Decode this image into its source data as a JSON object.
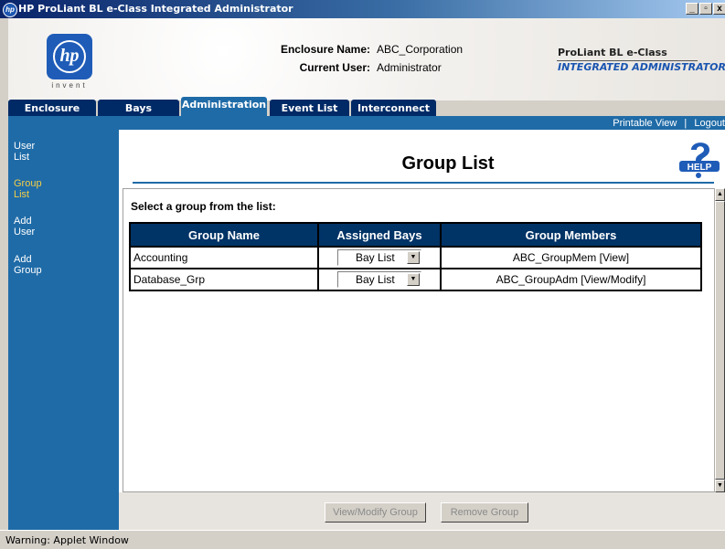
{
  "window": {
    "title": "HP ProLiant BL e-Class Integrated Administrator",
    "controls": {
      "minimize": "_",
      "maximize": "▫",
      "close": "x"
    }
  },
  "header": {
    "logo_text": "hp",
    "logo_tagline": "invent",
    "enclosure_name_label": "Enclosure Name:",
    "enclosure_name_value": "ABC_Corporation",
    "current_user_label": "Current User:",
    "current_user_value": "Administrator",
    "product_line1": "ProLiant BL e-Class",
    "product_line2": "INTEGRATED ADMINISTRATOR"
  },
  "tabs": [
    {
      "label": "Enclosure",
      "active": false
    },
    {
      "label": "Bays",
      "active": false
    },
    {
      "label": "Administration",
      "active": true
    },
    {
      "label": "Event List",
      "active": false
    },
    {
      "label": "Interconnect",
      "active": false
    }
  ],
  "utility_links": {
    "printable_view": "Printable View",
    "separator": "|",
    "logout": "Logout"
  },
  "sidebar": {
    "items": [
      {
        "line1": "User",
        "line2": "List",
        "active": false
      },
      {
        "line1": "Group",
        "line2": "List",
        "active": true
      },
      {
        "line1": "Add",
        "line2": "User",
        "active": false
      },
      {
        "line1": "Add",
        "line2": "Group",
        "active": false
      }
    ]
  },
  "main": {
    "page_title": "Group List",
    "help_label": "HELP",
    "help_icon": "question-mark-help-icon",
    "select_prompt": "Select a group from the list:",
    "table": {
      "headers": [
        "Group Name",
        "Assigned Bays",
        "Group Members"
      ],
      "rows": [
        {
          "group_name": "Accounting",
          "assigned_bays": "Bay List",
          "members": "ABC_GroupMem [View]"
        },
        {
          "group_name": "Database_Grp",
          "assigned_bays": "Bay List",
          "members": "ABC_GroupAdm [View/Modify]"
        }
      ]
    },
    "buttons": {
      "view_modify": "View/Modify Group",
      "remove": "Remove Group"
    }
  },
  "status_bar": {
    "text": "Warning: Applet Window"
  },
  "colors": {
    "titlebar_start": "#0a246a",
    "tab_inactive": "#002a66",
    "accent_blue": "#1f6ba7",
    "table_header": "#003366",
    "sidebar_active_text": "#f2ce47",
    "product_line2_text": "#1a55b0"
  }
}
